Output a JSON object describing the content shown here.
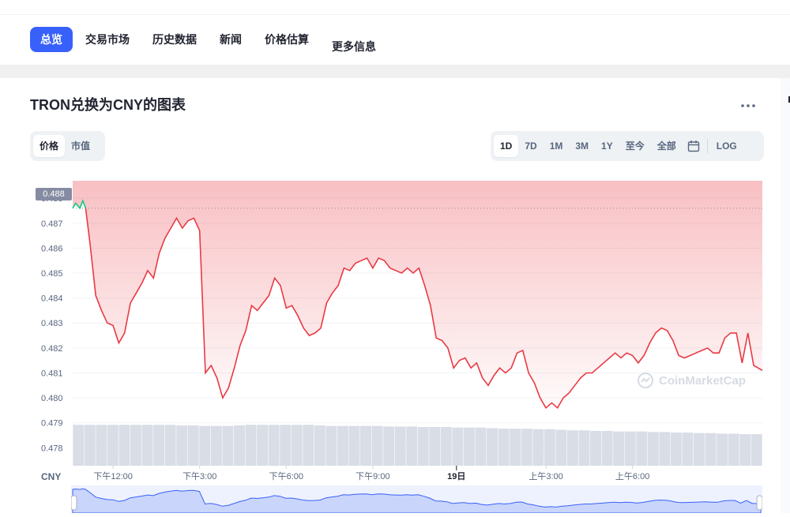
{
  "nav": {
    "tabs": [
      {
        "label": "总览",
        "active": true
      },
      {
        "label": "交易市场",
        "active": false
      },
      {
        "label": "历史数据",
        "active": false
      },
      {
        "label": "新闻",
        "active": false
      },
      {
        "label": "价格估算",
        "active": false
      },
      {
        "label": "更多信息",
        "active": false
      }
    ]
  },
  "chart_header": {
    "title": "TRON兑换为CNY的图表",
    "more_icon": "ellipsis-icon"
  },
  "view_toggle": {
    "options": [
      {
        "label": "价格",
        "active": true
      },
      {
        "label": "市值",
        "active": false
      }
    ]
  },
  "range_toggle": {
    "options": [
      {
        "label": "1D",
        "active": true
      },
      {
        "label": "7D",
        "active": false
      },
      {
        "label": "1M",
        "active": false
      },
      {
        "label": "3M",
        "active": false
      },
      {
        "label": "1Y",
        "active": false
      },
      {
        "label": "至今",
        "active": false
      },
      {
        "label": "全部",
        "active": false
      }
    ],
    "calendar_icon": "calendar-icon",
    "log_label": "LOG"
  },
  "current_price_label": "0.488",
  "currency_label": "CNY",
  "watermark_text": "CoinMarketCap",
  "colors": {
    "accent": "#3861fb",
    "line_down": "#ea3943",
    "line_up": "#16c784",
    "volume": "#d8dde6"
  },
  "chart_data": {
    "type": "line",
    "title": "TRON兑换为CNY的图表",
    "xlabel": "",
    "ylabel": "",
    "ylim": [
      0.4776,
      0.4887
    ],
    "y_ticks": [
      "0.478",
      "0.479",
      "0.480",
      "0.481",
      "0.482",
      "0.483",
      "0.484",
      "0.485",
      "0.486",
      "0.487",
      "0.488"
    ],
    "x_ticks": [
      "下午12:00",
      "下午3:00",
      "下午6:00",
      "下午9:00",
      "19日",
      "上午3:00",
      "上午6:00"
    ],
    "x_tick_hours": [
      1.4,
      4.4,
      7.4,
      10.4,
      13.3,
      16.4,
      19.4
    ],
    "x_range_hours": [
      0,
      23.9
    ],
    "grid": true,
    "reference_value": 0.4876,
    "series": [
      {
        "x": [
          0,
          0.1,
          0.25,
          0.35,
          0.45,
          0.6,
          0.8,
          1.0,
          1.2,
          1.4,
          1.6,
          1.8,
          2.0,
          2.2,
          2.4,
          2.6,
          2.8,
          3.0,
          3.2,
          3.4,
          3.6,
          3.8,
          4.0,
          4.2,
          4.4,
          4.6,
          4.8,
          5.0,
          5.2,
          5.4,
          5.6,
          5.8,
          6.0,
          6.2,
          6.4,
          6.6,
          6.8,
          7.0,
          7.2,
          7.4,
          7.6,
          7.8,
          8.0,
          8.2,
          8.4,
          8.6,
          8.8,
          9.0,
          9.2,
          9.4,
          9.6,
          9.8,
          10.0,
          10.2,
          10.4,
          10.6,
          10.8,
          11.0,
          11.2,
          11.4,
          11.6,
          11.8,
          12.0,
          12.2,
          12.4,
          12.6,
          12.8,
          13.0,
          13.2,
          13.4,
          13.6,
          13.8,
          14.0,
          14.2,
          14.4,
          14.6,
          14.8,
          15.0,
          15.2,
          15.4,
          15.6,
          15.8,
          16.0,
          16.2,
          16.4,
          16.6,
          16.8,
          17.0,
          17.2,
          17.4,
          17.6,
          17.8,
          18.0,
          18.2,
          18.4,
          18.6,
          18.8,
          19.0,
          19.2,
          19.4,
          19.6,
          19.8,
          20.0,
          20.2,
          20.4,
          20.6,
          20.8,
          21.0,
          21.2,
          21.4,
          21.6,
          21.8,
          22.0,
          22.2,
          22.4,
          22.6,
          22.8,
          23.0,
          23.2,
          23.4,
          23.6,
          23.9
        ],
        "y": [
          0.4876,
          0.4878,
          0.4876,
          0.4879,
          0.4876,
          0.4862,
          0.4841,
          0.4835,
          0.483,
          0.4829,
          0.4822,
          0.4826,
          0.4838,
          0.4842,
          0.4846,
          0.4851,
          0.4848,
          0.4858,
          0.4864,
          0.4868,
          0.4872,
          0.4868,
          0.4871,
          0.4872,
          0.4867,
          0.481,
          0.4813,
          0.4808,
          0.48,
          0.4804,
          0.4812,
          0.4821,
          0.4827,
          0.4837,
          0.4835,
          0.4838,
          0.4841,
          0.4848,
          0.4845,
          0.4836,
          0.4837,
          0.4833,
          0.4828,
          0.4825,
          0.4826,
          0.4828,
          0.4838,
          0.4842,
          0.4845,
          0.4852,
          0.4851,
          0.4854,
          0.4855,
          0.4856,
          0.4852,
          0.4856,
          0.4855,
          0.4852,
          0.4851,
          0.485,
          0.4852,
          0.485,
          0.4852,
          0.4845,
          0.4837,
          0.4824,
          0.4823,
          0.482,
          0.4812,
          0.4815,
          0.4816,
          0.4812,
          0.4814,
          0.4808,
          0.4805,
          0.4809,
          0.4812,
          0.481,
          0.4812,
          0.4818,
          0.4819,
          0.481,
          0.4806,
          0.48,
          0.4796,
          0.4798,
          0.4796,
          0.48,
          0.4802,
          0.4805,
          0.4808,
          0.481,
          0.481,
          0.4812,
          0.4814,
          0.4816,
          0.4818,
          0.4816,
          0.4818,
          0.4817,
          0.4814,
          0.4817,
          0.4822,
          0.4826,
          0.4828,
          0.4827,
          0.4823,
          0.4817,
          0.4816,
          0.4817,
          0.4818,
          0.4819,
          0.482,
          0.4818,
          0.4818,
          0.4824,
          0.4826,
          0.4826,
          0.4814,
          0.4826,
          0.4813,
          0.4811
        ]
      }
    ],
    "volume": [
      0.74,
      0.74,
      0.74,
      0.74,
      0.74,
      0.74,
      0.74,
      0.74,
      0.74,
      0.73,
      0.73,
      0.72,
      0.72,
      0.72,
      0.73,
      0.74,
      0.74,
      0.74,
      0.74,
      0.74,
      0.74,
      0.73,
      0.72,
      0.72,
      0.72,
      0.72,
      0.72,
      0.71,
      0.71,
      0.71,
      0.7,
      0.7,
      0.7,
      0.69,
      0.69,
      0.69,
      0.68,
      0.67,
      0.67,
      0.67,
      0.66,
      0.66,
      0.65,
      0.64,
      0.64,
      0.63,
      0.63,
      0.62,
      0.62,
      0.62,
      0.61,
      0.61,
      0.6,
      0.6,
      0.59,
      0.59,
      0.58,
      0.58,
      0.57,
      0.57
    ]
  }
}
